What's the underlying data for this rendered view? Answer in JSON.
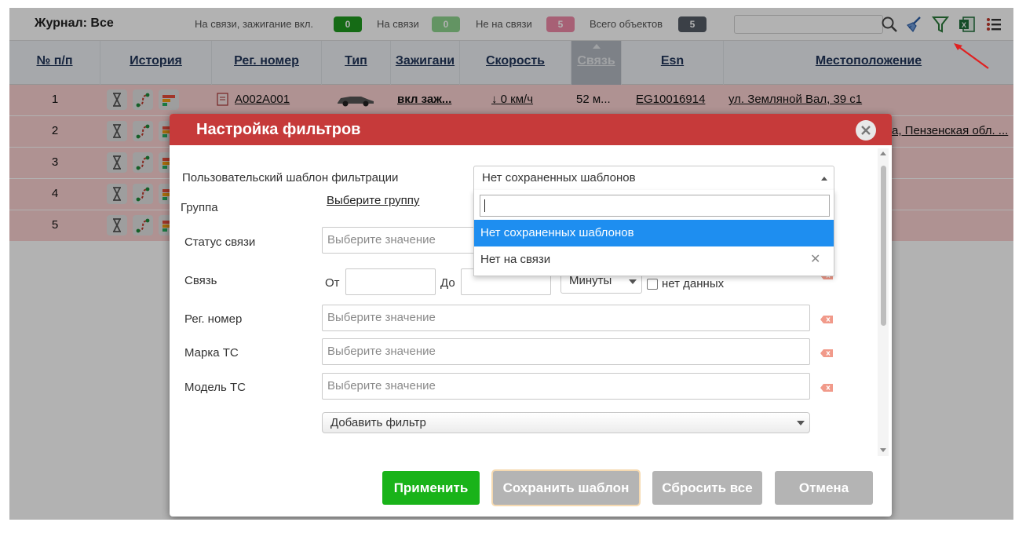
{
  "toolbar": {
    "journal_label": "Журнал: Все",
    "stats": [
      {
        "label": "На связи, зажигание вкл.",
        "count": "0",
        "color": "#1f9a1f"
      },
      {
        "label": "На связи",
        "count": "0",
        "color": "#8fd48f"
      },
      {
        "label": "Не на связи",
        "count": "5",
        "color": "#f08aa8"
      },
      {
        "label": "Всего объектов",
        "count": "5",
        "color": "#555c66"
      }
    ],
    "search_placeholder": "",
    "icons": [
      "search-icon",
      "broom-icon",
      "filter-icon",
      "excel-icon",
      "list-settings-icon"
    ]
  },
  "table": {
    "headers": [
      "№ п/п",
      "История",
      "Рег. номер",
      "Тип",
      "Зажигани",
      "Скорость",
      "Связь",
      "Esn",
      "Местоположение"
    ],
    "sorted_column": "Связь",
    "rows": [
      {
        "num": "1",
        "reg": "А002А001",
        "ignition": "вкл заж...",
        "speed": "↓ 0 км/ч",
        "link": "52 м...",
        "esn": "EG10016914",
        "location": "ул. Земляной Вал, 39 с1"
      },
      {
        "num": "2",
        "location_tail": "а, Пензенская обл. ..."
      },
      {
        "num": "3"
      },
      {
        "num": "4"
      },
      {
        "num": "5"
      }
    ]
  },
  "modal": {
    "title": "Настройка фильтров",
    "template_label": "Пользовательский шаблон фильтрации",
    "template_value": "Нет сохраненных шаблонов",
    "template_search_value": "",
    "template_options": [
      {
        "label": "Нет сохраненных шаблонов",
        "highlighted": true,
        "removable": false
      },
      {
        "label": "Нет на связи",
        "highlighted": false,
        "removable": true
      }
    ],
    "group_label": "Группа",
    "group_link": "Выберите группу",
    "status_label": "Статус связи",
    "status_placeholder": "Выберите значение",
    "link_label": "Связь",
    "from_label": "От",
    "to_label": "До",
    "from_value": "",
    "to_value": "",
    "unit_value": "Минуты",
    "no_data_label": "нет данных",
    "reg_label": "Рег. номер",
    "reg_placeholder": "Выберите значение",
    "brand_label": "Марка ТС",
    "brand_placeholder": "Выберите значение",
    "model_label": "Модель ТС",
    "model_placeholder": "Выберите значение",
    "add_filter_label": "Добавить фильтр",
    "buttons": {
      "apply": "Применить",
      "save_template": "Сохранить шаблон",
      "reset_all": "Сбросить все",
      "cancel": "Отмена"
    },
    "colors": {
      "header": "#c63a3a",
      "apply": "#19b319",
      "disabled": "#b4b4b4",
      "highlight": "#1e8ef0"
    }
  }
}
